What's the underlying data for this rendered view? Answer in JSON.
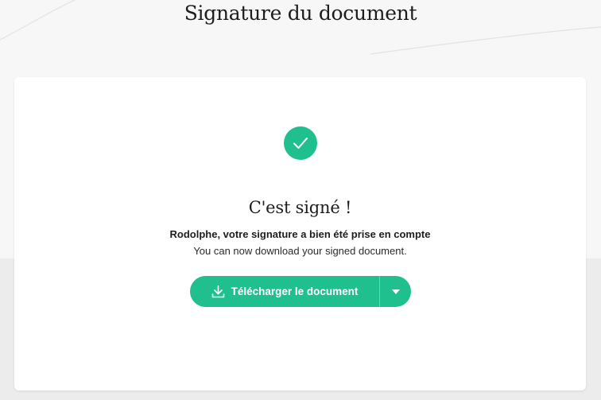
{
  "header": {
    "title": "Signature du document"
  },
  "card": {
    "status_icon": "check-icon",
    "title": "C'est signé !",
    "confirmation": "Rodolphe, votre signature a bien été prise en compte",
    "info": "You can now download your signed document.",
    "download_button_label": "Télécharger le document",
    "download_icon": "download-icon",
    "dropdown_icon": "caret-down-icon"
  },
  "colors": {
    "accent": "#20bf8e",
    "background": "#f7f7f7",
    "card": "#ffffff",
    "text": "#1d1d1d"
  }
}
